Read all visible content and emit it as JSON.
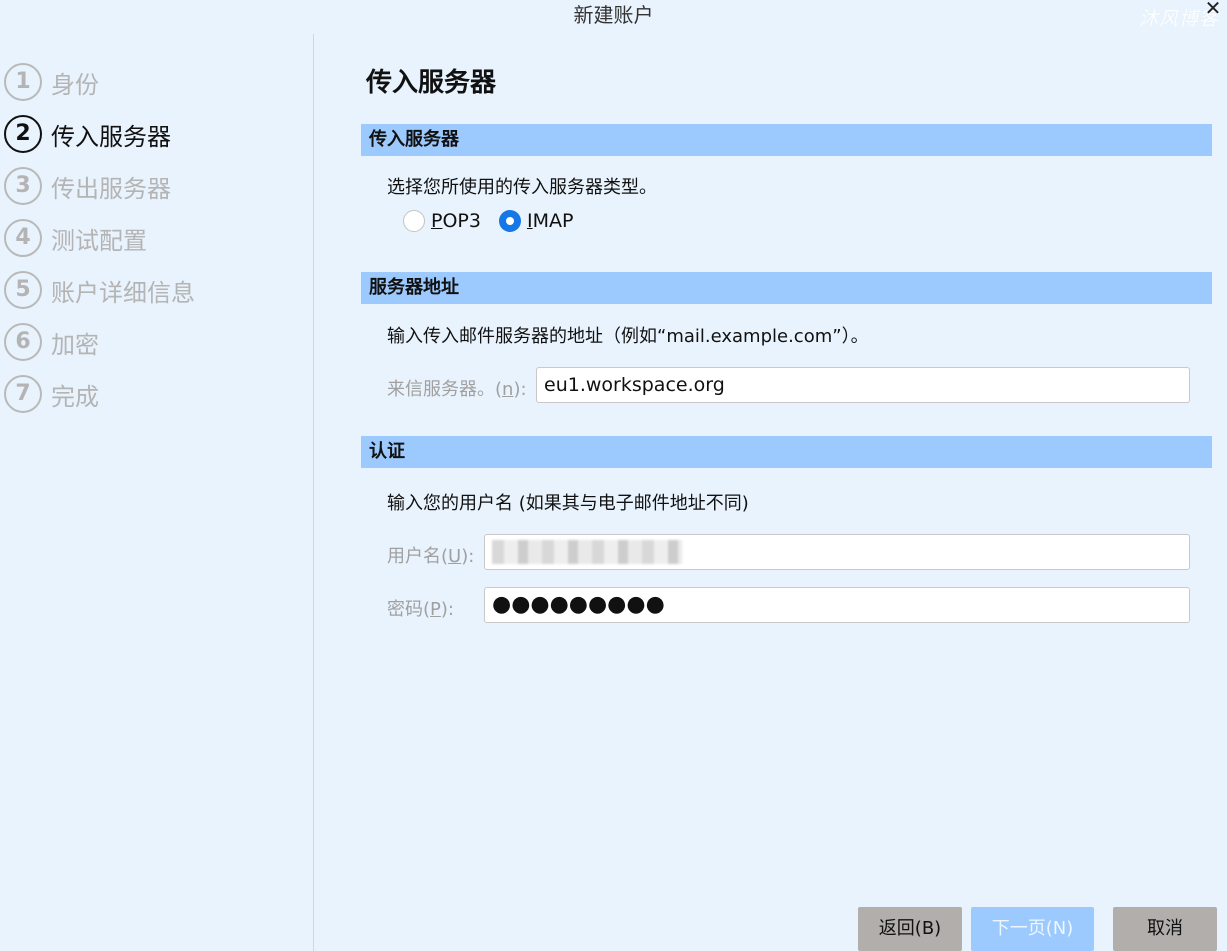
{
  "window": {
    "title": "新建账户",
    "watermark": "沐风博客",
    "close_icon": "close-icon"
  },
  "sidebar": {
    "steps": [
      {
        "num": "1",
        "label": "身份",
        "active": false
      },
      {
        "num": "2",
        "label": "传入服务器",
        "active": true
      },
      {
        "num": "3",
        "label": "传出服务器",
        "active": false
      },
      {
        "num": "4",
        "label": "测试配置",
        "active": false
      },
      {
        "num": "5",
        "label": "账户详细信息",
        "active": false
      },
      {
        "num": "6",
        "label": "加密",
        "active": false
      },
      {
        "num": "7",
        "label": "完成",
        "active": false
      }
    ]
  },
  "main": {
    "title": "传入服务器",
    "server_type": {
      "header": "传入服务器",
      "description": "选择您所使用的传入服务器类型。",
      "options": [
        {
          "mnemonic": "P",
          "rest": "OP3",
          "checked": false
        },
        {
          "mnemonic": "I",
          "rest": "MAP",
          "checked": true
        }
      ]
    },
    "server_address": {
      "header": "服务器地址",
      "description": "输入传入邮件服务器的地址（例如“mail.example.com”）。",
      "label_prefix": "来信服务器。(",
      "label_mnemonic": "n",
      "label_suffix": "):",
      "value": "eu1.workspace.org"
    },
    "authentication": {
      "header": "认证",
      "description": "输入您的用户名 (如果其与电子邮件地址不同)",
      "username_label_prefix": "用户名(",
      "username_label_mnemonic": "U",
      "username_label_suffix": "):",
      "username_value": "",
      "password_label_prefix": "密码(",
      "password_label_mnemonic": "P",
      "password_label_suffix": "):",
      "password_masked": "●●●●●●●●●"
    }
  },
  "buttons": {
    "back": "返回(B)",
    "next": "下一页(N)",
    "cancel": "取消"
  }
}
